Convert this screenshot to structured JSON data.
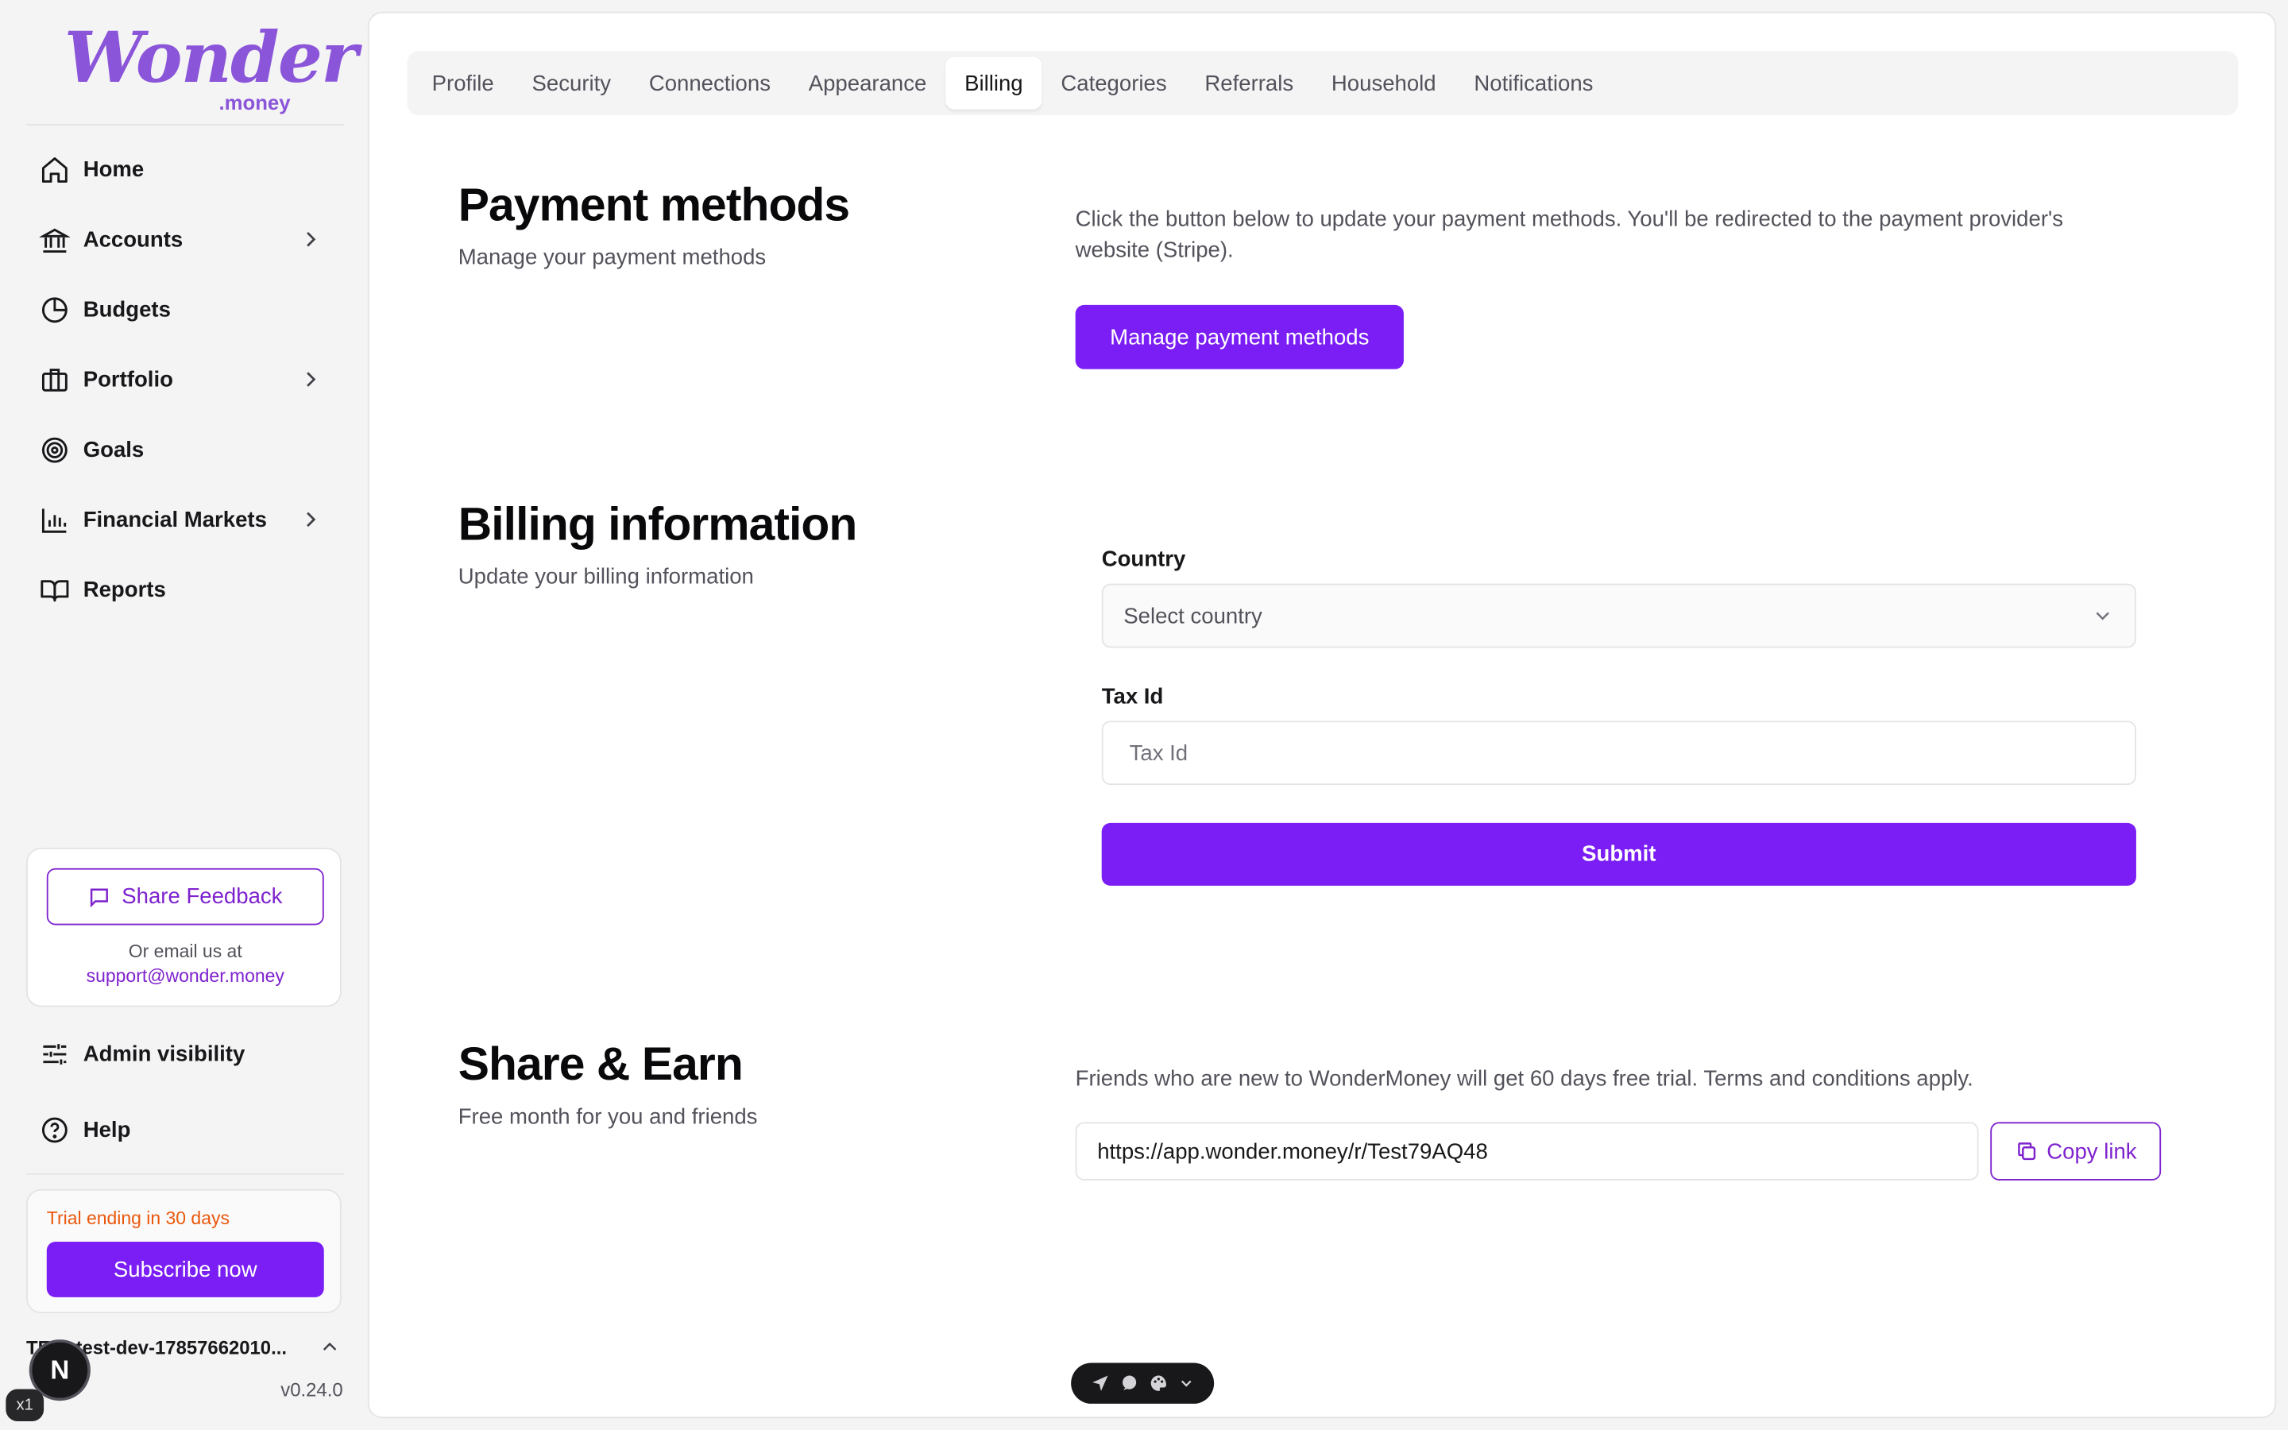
{
  "brand": {
    "logo_word": "Wonder",
    "logo_sub": ".money",
    "accent": "#7a1ef5",
    "logo_color": "#8b55d9"
  },
  "sidebar": {
    "items": [
      {
        "label": "Home",
        "icon": "home-icon",
        "has_submenu": false
      },
      {
        "label": "Accounts",
        "icon": "bank-icon",
        "has_submenu": true
      },
      {
        "label": "Budgets",
        "icon": "pie-chart-icon",
        "has_submenu": false
      },
      {
        "label": "Portfolio",
        "icon": "briefcase-icon",
        "has_submenu": true
      },
      {
        "label": "Goals",
        "icon": "target-icon",
        "has_submenu": false
      },
      {
        "label": "Financial Markets",
        "icon": "bar-chart-icon",
        "has_submenu": true
      },
      {
        "label": "Reports",
        "icon": "book-icon",
        "has_submenu": false
      }
    ],
    "feedback": {
      "button_label": "Share Feedback",
      "email_prefix": "Or email us at",
      "email": "support@wonder.money"
    },
    "admin_visibility": "Admin visibility",
    "help": "Help",
    "trial": {
      "text": "Trial ending in 30 days",
      "button_label": "Subscribe now"
    },
    "user": {
      "initials": "TE",
      "name": "test-dev-17857662010..."
    },
    "version": "v0.24.0",
    "dev_badge": "N",
    "dev_multiplier": "x1"
  },
  "tabs": [
    {
      "label": "Profile",
      "active": false
    },
    {
      "label": "Security",
      "active": false
    },
    {
      "label": "Connections",
      "active": false
    },
    {
      "label": "Appearance",
      "active": false
    },
    {
      "label": "Billing",
      "active": true
    },
    {
      "label": "Categories",
      "active": false
    },
    {
      "label": "Referrals",
      "active": false
    },
    {
      "label": "Household",
      "active": false
    },
    {
      "label": "Notifications",
      "active": false
    }
  ],
  "payment_methods": {
    "title": "Payment methods",
    "subtitle": "Manage your payment methods",
    "description": "Click the button below to update your payment methods. You'll be redirected to the payment provider's website (Stripe).",
    "button_label": "Manage payment methods"
  },
  "billing_info": {
    "title": "Billing information",
    "subtitle": "Update your billing information",
    "country_label": "Country",
    "country_placeholder": "Select country",
    "tax_label": "Tax Id",
    "tax_placeholder": "Tax Id",
    "submit_label": "Submit"
  },
  "share_earn": {
    "title": "Share & Earn",
    "subtitle": "Free month for you and friends",
    "description": "Friends who are new to WonderMoney will get 60 days free trial. Terms and conditions apply.",
    "link": "https://app.wonder.money/r/Test79AQ48",
    "copy_label": "Copy link"
  }
}
